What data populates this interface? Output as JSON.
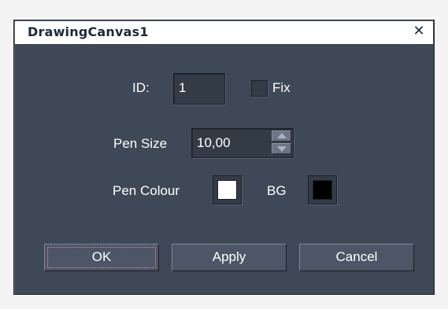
{
  "dialog": {
    "title": "DrawingCanvas1",
    "close_glyph": "✕"
  },
  "form": {
    "id_label": "ID:",
    "id_value": "1",
    "fix_label": "Fix",
    "fix_checked": false,
    "pen_size_label": "Pen Size",
    "pen_size_value": "10,00",
    "pen_colour_label": "Pen Colour",
    "pen_colour": "#ffffff",
    "bg_label": "BG",
    "bg_colour": "#000000"
  },
  "buttons": {
    "ok": "OK",
    "apply": "Apply",
    "cancel": "Cancel"
  },
  "colors": {
    "dialog_bg": "#3f4856",
    "titlebar_bg": "#ffffff",
    "title_text": "#1d2b3a"
  },
  "icons": {
    "close": "close-icon",
    "spin_up": "triangle-up-icon",
    "spin_down": "triangle-down-icon"
  }
}
